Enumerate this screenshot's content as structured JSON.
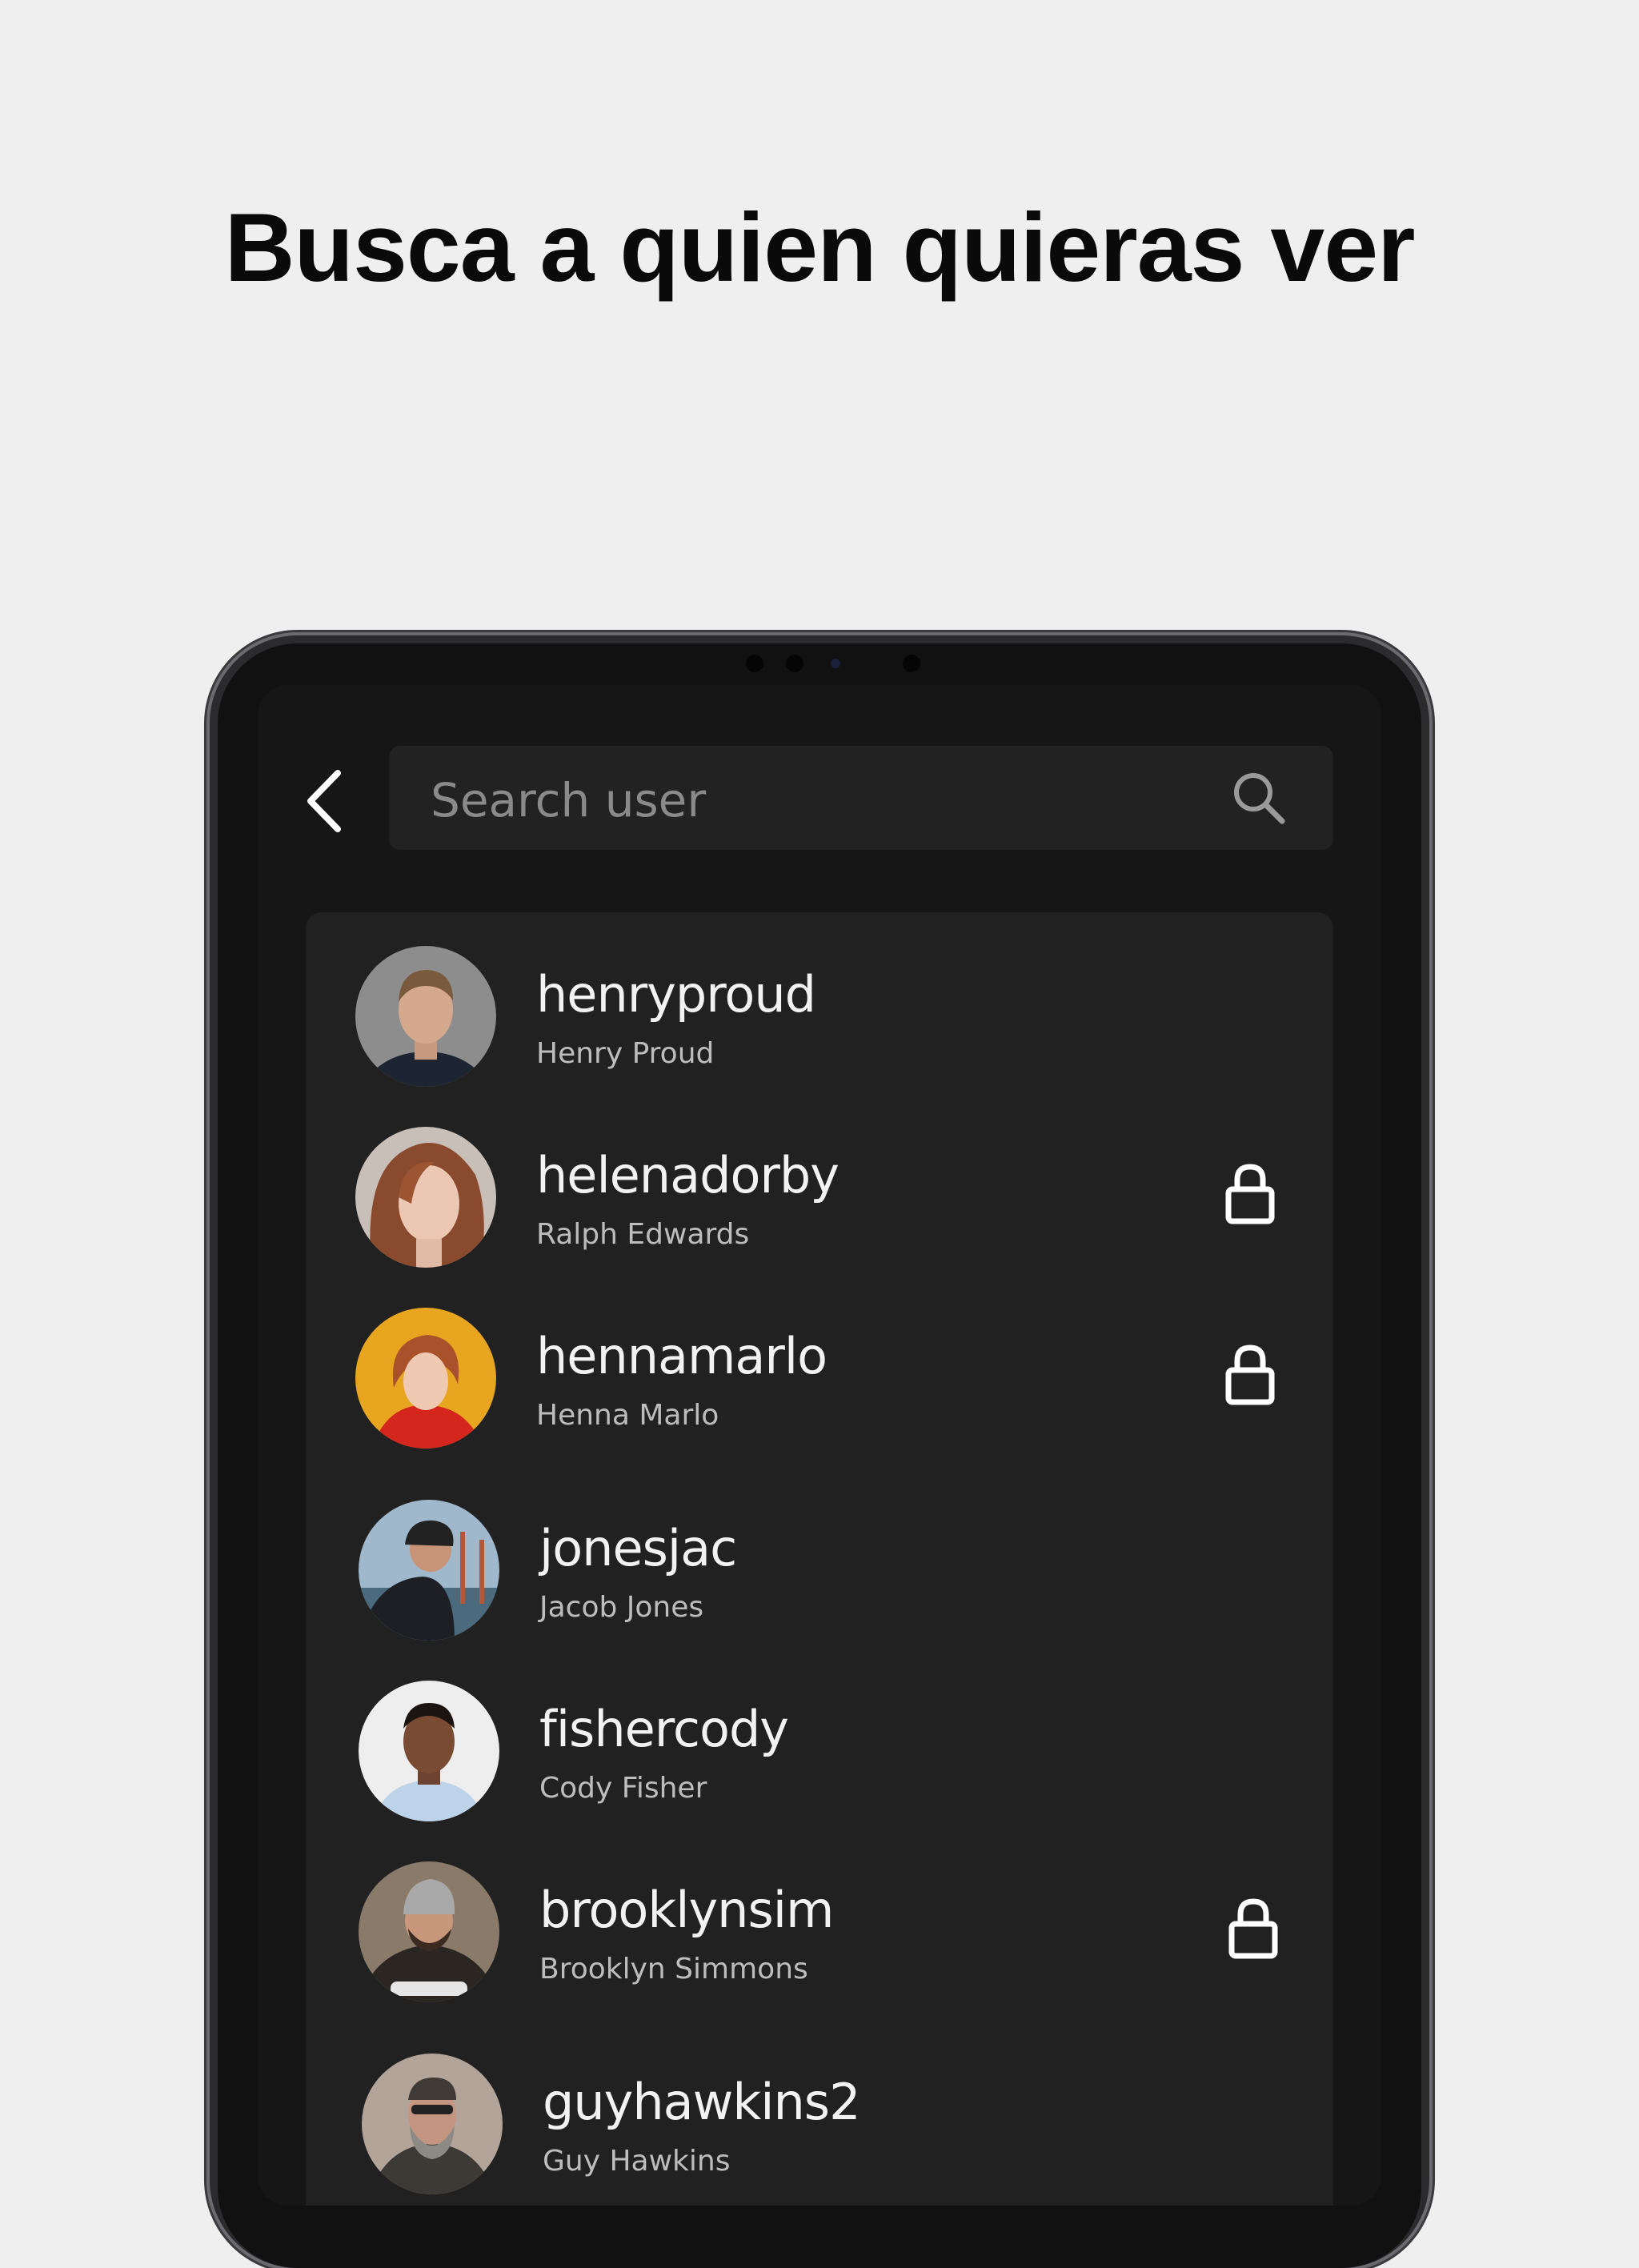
{
  "headline": "Busca a quien quieras ver",
  "search": {
    "placeholder": "Search user"
  },
  "icons": {
    "back": "chevron-left-icon",
    "search": "search-icon",
    "lock": "lock-icon"
  },
  "colors": {
    "page_bg": "#efefef",
    "screen_bg": "#161616",
    "panel_bg": "#212121",
    "text": "#f2f2f2",
    "subtext": "#bdbdbd"
  },
  "users": [
    {
      "username": "henryproud",
      "name": "Henry Proud",
      "locked": false
    },
    {
      "username": "helenadorby",
      "name": "Ralph Edwards",
      "locked": true
    },
    {
      "username": "hennamarlo",
      "name": "Henna Marlo",
      "locked": true
    },
    {
      "username": "jonesjac",
      "name": "Jacob Jones",
      "locked": false
    },
    {
      "username": "fishercody",
      "name": "Cody Fisher",
      "locked": false
    },
    {
      "username": "brooklynsim",
      "name": "Brooklyn Simmons",
      "locked": true
    },
    {
      "username": "guyhawkins2",
      "name": "Guy Hawkins",
      "locked": false
    }
  ]
}
